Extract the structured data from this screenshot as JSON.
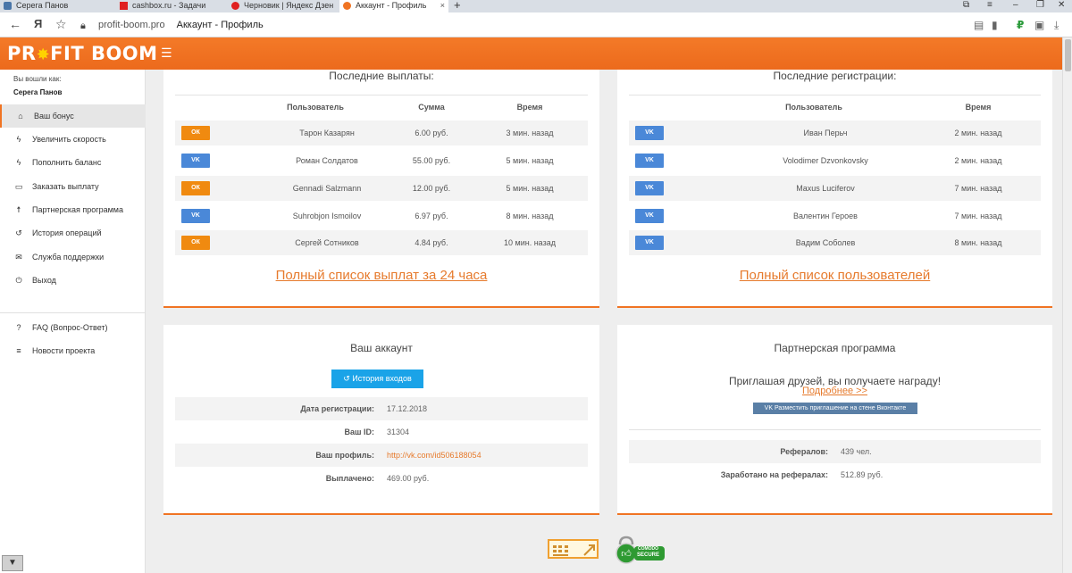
{
  "browser": {
    "tabs": [
      {
        "title": "Серега Панов",
        "icon_color": "#4a76a8"
      },
      {
        "title": "cashbox.ru - Задачи",
        "icon_color": "#e02020"
      },
      {
        "title": "Черновик | Яндекс Дзен",
        "icon_color": "#e02020"
      },
      {
        "title": "Аккаунт - Профиль",
        "icon_color": "#f07423"
      }
    ],
    "host": "profit-boom.pro",
    "page_title": "Аккаунт - Профиль",
    "new_tab": "+",
    "close_glyph": "×"
  },
  "header": {
    "logo_left": "PR",
    "logo_star": "✸",
    "logo_right": "FIT BOOM",
    "burger": "☰"
  },
  "sidebar": {
    "logged_label": "Вы вошли как:",
    "user_name": "Серега Панов",
    "items": [
      {
        "label": "Ваш бонус",
        "icon": "home-icon",
        "glyph": "⌂"
      },
      {
        "label": "Увеличить скорость",
        "icon": "bolt-icon",
        "glyph": "ϟ"
      },
      {
        "label": "Пополнить баланс",
        "icon": "bolt-icon",
        "glyph": "ϟ"
      },
      {
        "label": "Заказать выплату",
        "icon": "credit-card-icon",
        "glyph": "▭"
      },
      {
        "label": "Партнерская программа",
        "icon": "person-icon",
        "glyph": "☨"
      },
      {
        "label": "История операций",
        "icon": "history-icon",
        "glyph": "↺"
      },
      {
        "label": "Служба поддержки",
        "icon": "envelope-icon",
        "glyph": "✉"
      },
      {
        "label": "Выход",
        "icon": "power-icon",
        "glyph": "⏻"
      },
      {
        "label": "FAQ (Вопрос-Ответ)",
        "icon": "question-icon",
        "glyph": "?"
      },
      {
        "label": "Новости проекта",
        "icon": "list-icon",
        "glyph": "≡"
      }
    ]
  },
  "payouts": {
    "title": "Последние выплаты:",
    "headers": {
      "user": "Пользователь",
      "sum": "Сумма",
      "time": "Время"
    },
    "rows": [
      {
        "badge": "ОК",
        "type": "ok",
        "user": "Тарон Казарян",
        "sum": "6.00 руб.",
        "time": "3 мин. назад"
      },
      {
        "badge": "VK",
        "type": "vk",
        "user": "Роман Солдатов",
        "sum": "55.00 руб.",
        "time": "5 мин. назад"
      },
      {
        "badge": "ОК",
        "type": "ok",
        "user": "Gennadi Salzmann",
        "sum": "12.00 руб.",
        "time": "5 мин. назад"
      },
      {
        "badge": "VK",
        "type": "vk",
        "user": "Suhrobjon Ismoilov",
        "sum": "6.97 руб.",
        "time": "8 мин. назад"
      },
      {
        "badge": "ОК",
        "type": "ok",
        "user": "Сергей Сотников",
        "sum": "4.84 руб.",
        "time": "10 мин. назад"
      }
    ],
    "full_list": "Полный список выплат за 24 часа"
  },
  "registrations": {
    "title": "Последние регистрации:",
    "headers": {
      "user": "Пользователь",
      "time": "Время"
    },
    "rows": [
      {
        "badge": "VK",
        "user": "Иван Перьч",
        "time": "2 мин. назад"
      },
      {
        "badge": "VK",
        "user": "Volodimer Dzvonkovsky",
        "time": "2 мин. назад"
      },
      {
        "badge": "VK",
        "user": "Maxus Luciferov",
        "time": "7 мин. назад"
      },
      {
        "badge": "VK",
        "user": "Валентин Героев",
        "time": "7 мин. назад"
      },
      {
        "badge": "VK",
        "user": "Вадим Соболев",
        "time": "8 мин. назад"
      }
    ],
    "full_list": "Полный список пользователей"
  },
  "account": {
    "title": "Ваш аккаунт",
    "history_button": "История входов",
    "rows": [
      {
        "label": "Дата регистрации:",
        "value": "17.12.2018"
      },
      {
        "label": "Ваш ID:",
        "value": "31304"
      },
      {
        "label": "Ваш профиль:",
        "value": "http://vk.com/id506188054"
      },
      {
        "label": "Выплачено:",
        "value": "469.00 руб."
      }
    ]
  },
  "partner": {
    "title": "Партнерская программа",
    "invite_text": "Приглашая друзей, вы получаете награду!",
    "more_link": "Подробнее >>",
    "vk_share": "Разместить приглашение на стене Вконтакте",
    "rows": [
      {
        "label": "Рефералов:",
        "value": "439 чел."
      },
      {
        "label": "Заработано на рефералах:",
        "value": "512.89 руб."
      }
    ]
  },
  "footer": {
    "badge_comodo": "COMODO",
    "badge_secure": "SECURE"
  },
  "colors": {
    "accent": "#f07423",
    "ok_badge": "#f08a10",
    "vk_badge": "#4a88d8",
    "blue_button": "#1aa3e8"
  }
}
